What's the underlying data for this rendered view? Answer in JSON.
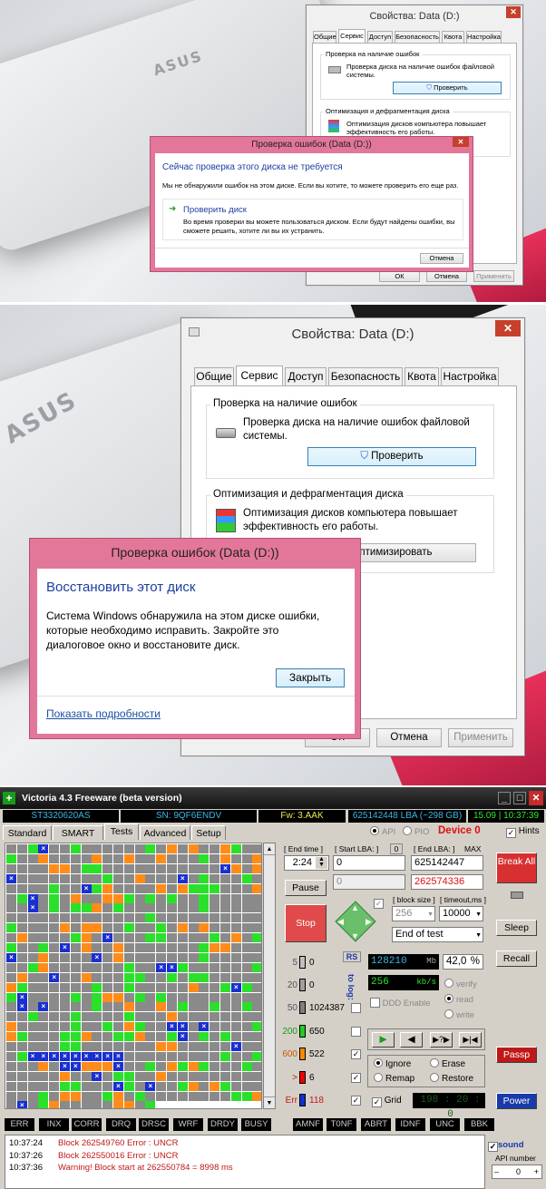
{
  "panel1": {
    "props": {
      "title": "Свойства: Data (D:)",
      "tabs": [
        "Общие",
        "Сервис",
        "Доступ",
        "Безопасность",
        "Квота",
        "Настройка"
      ],
      "group1": "Проверка на наличие ошибок",
      "group1_text": "Проверка диска на наличие ошибок файловой системы.",
      "check_button": "Проверить",
      "group2": "Оптимизация и дефрагментация диска",
      "group2_text": "Оптимизация дисков компьютера повышает эффективность его работы.",
      "ok": "ОК",
      "cancel": "Отмена",
      "apply": "Применить"
    },
    "dialog": {
      "title": "Проверка ошибок (Data (D:))",
      "heading": "Сейчас проверка этого диска не требуется",
      "text": "Мы не обнаружили ошибок на этом диске. Если вы хотите, то можете проверить его еще раз.",
      "option_title": "Проверить диск",
      "option_text": "Во время проверки вы можете пользоваться диском. Если будут найдены ошибки, вы сможете решить, хотите ли вы их устранить.",
      "cancel": "Отмена"
    }
  },
  "panel2": {
    "props": {
      "title": "Свойства: Data (D:)",
      "tabs": [
        "Общие",
        "Сервис",
        "Доступ",
        "Безопасность",
        "Квота",
        "Настройка"
      ],
      "group1": "Проверка на наличие ошибок",
      "group1_text": "Проверка диска на наличие ошибок файловой системы.",
      "check_button": "Проверить",
      "group2": "Оптимизация и дефрагментация диска",
      "group2_text": "Оптимизация дисков компьютера повышает эффективность его работы.",
      "optimize_button": "Оптимизировать",
      "ok": "ОК",
      "cancel": "Отмена",
      "apply": "Применить"
    },
    "dialog": {
      "title": "Проверка ошибок (Data (D:))",
      "heading": "Восстановить этот диск",
      "text": "Система Windows обнаружила на этом диске ошибки, которые необходимо исправить. Закройте это диалоговое окно и восстановите диск.",
      "close_button": "Закрыть",
      "details_link": "Показать подробности"
    }
  },
  "logo_text": "ASUS",
  "victoria": {
    "title": "Victoria 4.3 Freeware (beta version)",
    "model": "ST3320620AS",
    "serial": "SN: 9QF6ENDV",
    "firmware": "Fw: 3.AAK",
    "lba_info": "625142448 LBA (~298 GB)",
    "clock": "15.09 | 10:37:39",
    "tabs": [
      "Standard",
      "SMART",
      "Tests",
      "Advanced",
      "Setup"
    ],
    "api": "API",
    "pio": "PIO",
    "device": "Device 0",
    "hints": "Hints",
    "end_time_label": "[ End time ]",
    "end_time": "2:24",
    "start_lba_label": "[ Start LBA: ]",
    "start_lba_zero": "0",
    "start_lba": "0",
    "end_lba_label": "[ End LBA: ]",
    "max_label": "MAX",
    "end_lba": "625142447",
    "current_lba": "262574336",
    "pos_field": "0",
    "pause": "Pause",
    "stop": "Stop",
    "block_size_label": "[ block size ]",
    "timeout_label": "[ timeout,ms ]",
    "block_size": "256",
    "timeout": "10000",
    "end_of_test": "End of test",
    "legend": [
      {
        "label": "5",
        "count": "0",
        "color": "#c0c0c0"
      },
      {
        "label": "20",
        "count": "0",
        "color": "#a0a0a0"
      },
      {
        "label": "50",
        "count": "1024387",
        "color": "#808080"
      },
      {
        "label": "200",
        "count": "650",
        "color": "#22cc22"
      },
      {
        "label": "600",
        "count": "522",
        "color": "#ff8800"
      },
      {
        "label": ">",
        "count": "6",
        "color": "#ee0000"
      },
      {
        "label": "Err",
        "count": "118",
        "color": "#1030d0"
      }
    ],
    "rs": "RS",
    "to_log": "to log:",
    "mb_value": "128210",
    "mb_unit": "Mb",
    "percent": "42,0",
    "percent_unit": "%",
    "speed": "256",
    "speed_unit": "kb/s",
    "verify": "verify",
    "read": "read",
    "write": "write",
    "ddd": "DDD Enable",
    "ignore": "Ignore",
    "erase": "Erase",
    "remap": "Remap",
    "restore": "Restore",
    "grid_label": "Grid",
    "grid_time": "198 : 20 : 0",
    "side_buttons": {
      "break_all": "Break All",
      "sleep": "Sleep",
      "recall": "Recall",
      "passp": "Passp",
      "power": "Power"
    },
    "status": [
      "ERR",
      "INX",
      "CORR",
      "DRQ",
      "DRSC",
      "WRF",
      "DRDY",
      "BUSY",
      "AMNF",
      "T0NF",
      "ABRT",
      "IDNF",
      "UNC",
      "BBK"
    ],
    "log": [
      {
        "time": "10:37:24",
        "msg": "Block 262549760 Error : UNCR"
      },
      {
        "time": "10:37:26",
        "msg": "Block 262550016 Error : UNCR"
      },
      {
        "time": "10:37:36",
        "msg": "Warning! Block start at 262550784 = 8998 ms"
      }
    ],
    "sound": "sound",
    "api_number": "API number",
    "api_value": "0"
  }
}
